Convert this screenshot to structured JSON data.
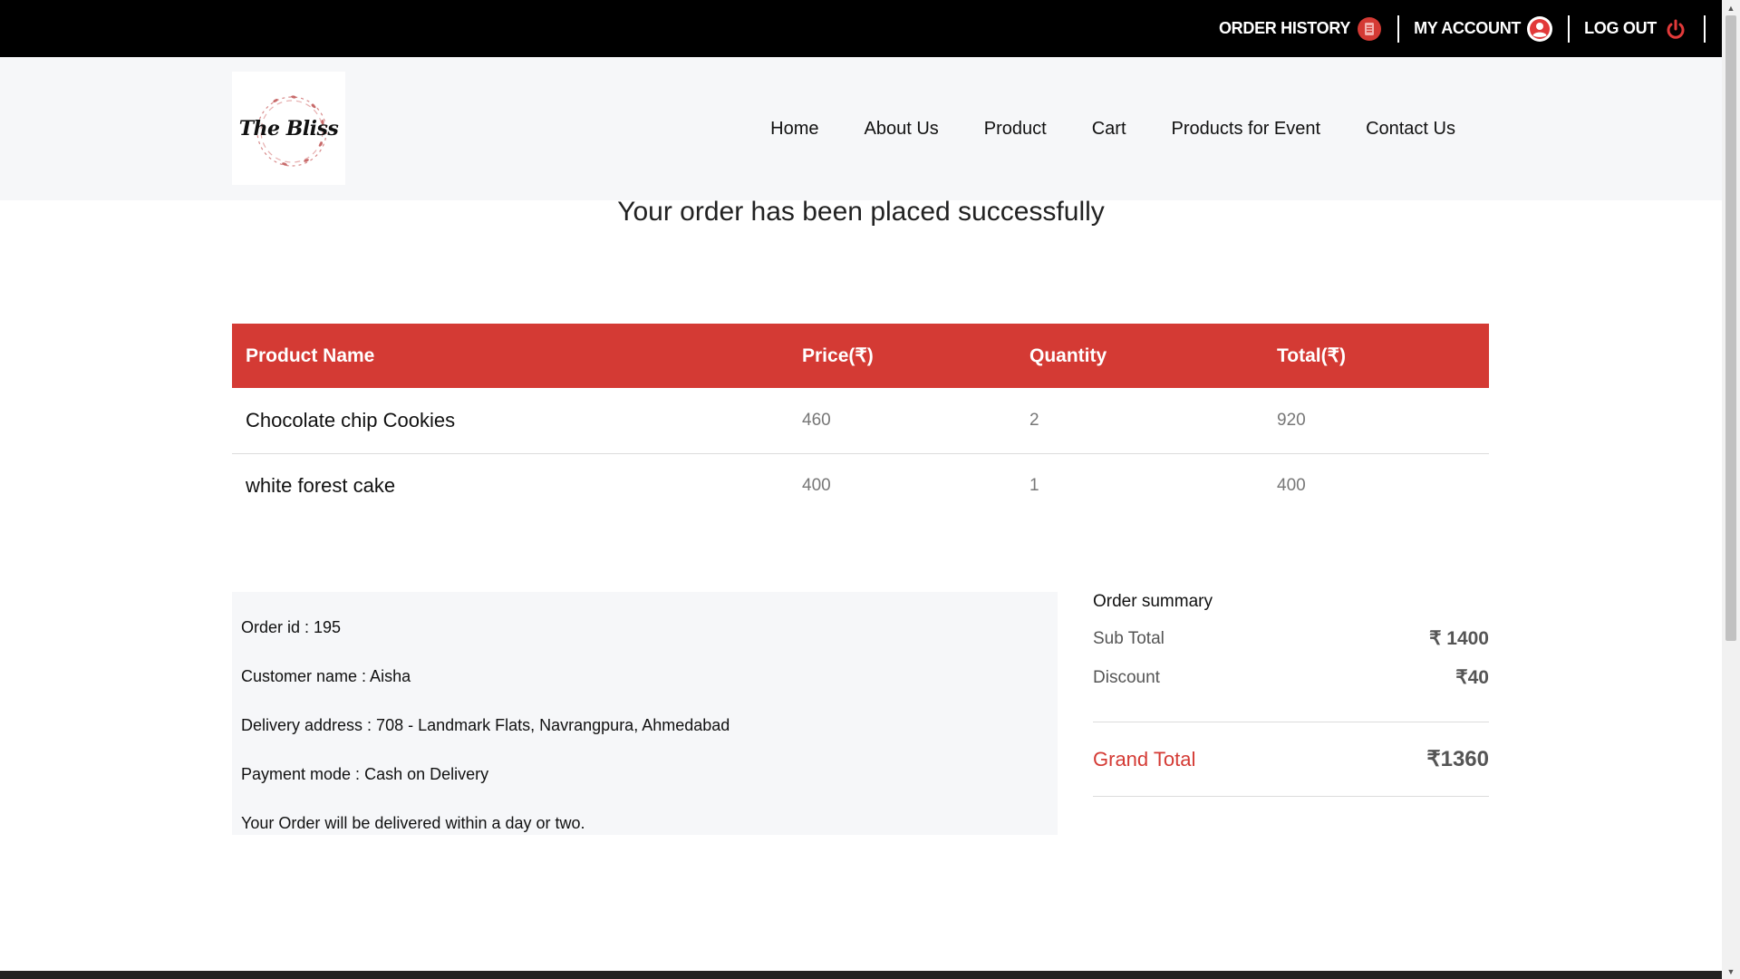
{
  "topbar": {
    "order_history": "ORDER HISTORY",
    "my_account": "MY ACCOUNT",
    "logout": "LOG OUT"
  },
  "brand": {
    "logo_text": "The Bliss"
  },
  "nav": {
    "items": [
      "Home",
      "About Us",
      "Product",
      "Cart",
      "Products for Event",
      "Contact Us"
    ]
  },
  "success_message": "Your order has been placed successfully",
  "table": {
    "headers": [
      "Product Name",
      "Price(₹)",
      "Quantity",
      "Total(₹)"
    ],
    "rows": [
      {
        "name": "Chocolate chip Cookies",
        "price": "460",
        "qty": "2",
        "total": "920"
      },
      {
        "name": "white forest cake",
        "price": "400",
        "qty": "1",
        "total": "400"
      }
    ]
  },
  "info": {
    "order_id": "Order id : 195",
    "customer": "Customer name : Aisha",
    "address": "Delivery address : 708 - Landmark Flats, Navrangpura, Ahmedabad",
    "payment": "Payment mode : Cash on Delivery",
    "note": "Your Order will be delivered within a day or two."
  },
  "summary": {
    "title": "Order summary",
    "subtotal_label": "Sub Total",
    "subtotal_value": "₹ 1400",
    "discount_label": "Discount",
    "discount_value": "₹40",
    "grand_label": "Grand Total",
    "grand_value": "₹1360"
  },
  "colors": {
    "accent": "#d43a34",
    "topbar": "#000000",
    "header_bg": "#f6f7f9"
  },
  "icons": {
    "order_history": "clipboard-icon",
    "my_account": "user-circle-icon",
    "logout": "power-icon"
  }
}
